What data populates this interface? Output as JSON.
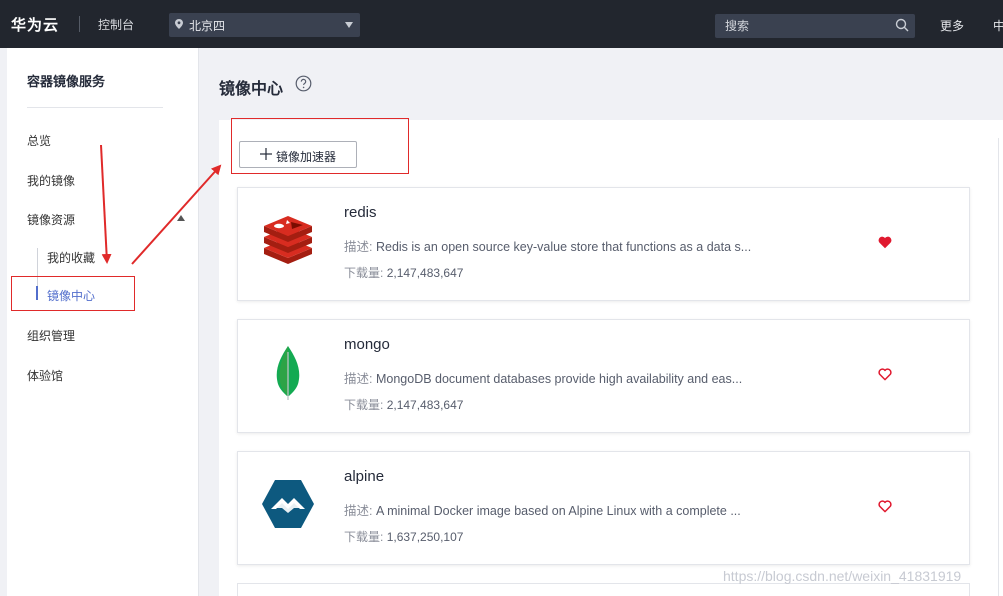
{
  "topbar": {
    "logo": "华为云",
    "console": "控制台",
    "region": "北京四",
    "search_placeholder": "搜索",
    "more": "更多",
    "cut_text": "中"
  },
  "sidebar": {
    "title": "容器镜像服务",
    "items": [
      {
        "label": "总览"
      },
      {
        "label": "我的镜像"
      },
      {
        "label": "镜像资源"
      },
      {
        "label": "组织管理"
      },
      {
        "label": "体验馆"
      }
    ],
    "subitems": [
      {
        "label": "我的收藏"
      },
      {
        "label": "镜像中心"
      }
    ]
  },
  "main": {
    "title": "镜像中心",
    "accelerator_button": "镜像加速器",
    "desc_label": "描述:",
    "downloads_label": "下载量:",
    "images": [
      {
        "name": "redis",
        "desc": "Redis is an open source key-value store that functions as a data s...",
        "downloads": "2,147,483,647",
        "favorited": true,
        "icon": "redis-logo-icon"
      },
      {
        "name": "mongo",
        "desc": "MongoDB document databases provide high availability and eas...",
        "downloads": "2,147,483,647",
        "favorited": false,
        "icon": "mongo-leaf-icon"
      },
      {
        "name": "alpine",
        "desc": "A minimal Docker image based on Alpine Linux with a complete ...",
        "downloads": "1,637,250,107",
        "favorited": false,
        "icon": "alpine-logo-icon"
      }
    ]
  },
  "watermark": "https://blog.csdn.net/weixin_41831919",
  "colors": {
    "accent": "#526ecc",
    "annotation": "#e02a2a",
    "heart": "#e0192f",
    "topbar": "#22262e"
  }
}
